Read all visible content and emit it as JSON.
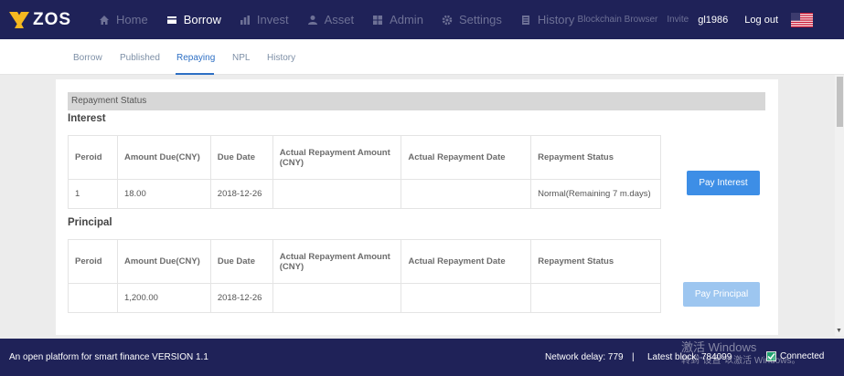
{
  "brand": {
    "logo_text": "ZOS"
  },
  "nav": {
    "items": [
      {
        "label": "Home",
        "icon": "home-icon"
      },
      {
        "label": "Borrow",
        "icon": "borrow-icon",
        "active": true
      },
      {
        "label": "Invest",
        "icon": "invest-icon"
      },
      {
        "label": "Asset",
        "icon": "asset-icon"
      },
      {
        "label": "Admin",
        "icon": "admin-icon"
      },
      {
        "label": "Settings",
        "icon": "gear-icon"
      },
      {
        "label": "History",
        "icon": "history-icon"
      }
    ],
    "blockchain_browser": "Blockchain Browser",
    "invite": "Invite",
    "username": "gl1986",
    "logout": "Log out",
    "flag": "us-flag-icon"
  },
  "subtabs": [
    "Borrow",
    "Published",
    "Repaying",
    "NPL",
    "History"
  ],
  "active_subtab": "Repaying",
  "repayment": {
    "status_bar": "Repayment Status",
    "headers": [
      "Peroid",
      "Amount Due(CNY)",
      "Due Date",
      "Actual Repayment Amount (CNY)",
      "Actual Repayment Date",
      "Repayment Status"
    ],
    "interest": {
      "title": "Interest",
      "row": [
        "1",
        "18.00",
        "2018-12-26",
        "",
        "",
        "Normal(Remaining 7 m.days)"
      ],
      "button": "Pay Interest"
    },
    "principal": {
      "title": "Principal",
      "row": [
        "",
        "1,200.00",
        "2018-12-26",
        "",
        "",
        ""
      ],
      "button": "Pay Principal"
    }
  },
  "footer": {
    "platform": "An open platform for smart finance VERSION 1.1",
    "network_delay_label": "Network delay:",
    "network_delay": "779",
    "separator": "|",
    "latest_block_label": "Latest block:",
    "latest_block": "784099",
    "connected": "Connected"
  },
  "watermark": {
    "line1": "激活 Windows",
    "line2": "转到\"设置\"以激活 Windows。"
  },
  "colors": {
    "nav_bg": "#1f2258",
    "accent": "#3d8ee6",
    "accent_disabled": "#9dc6f0",
    "connected": "#20a070"
  }
}
